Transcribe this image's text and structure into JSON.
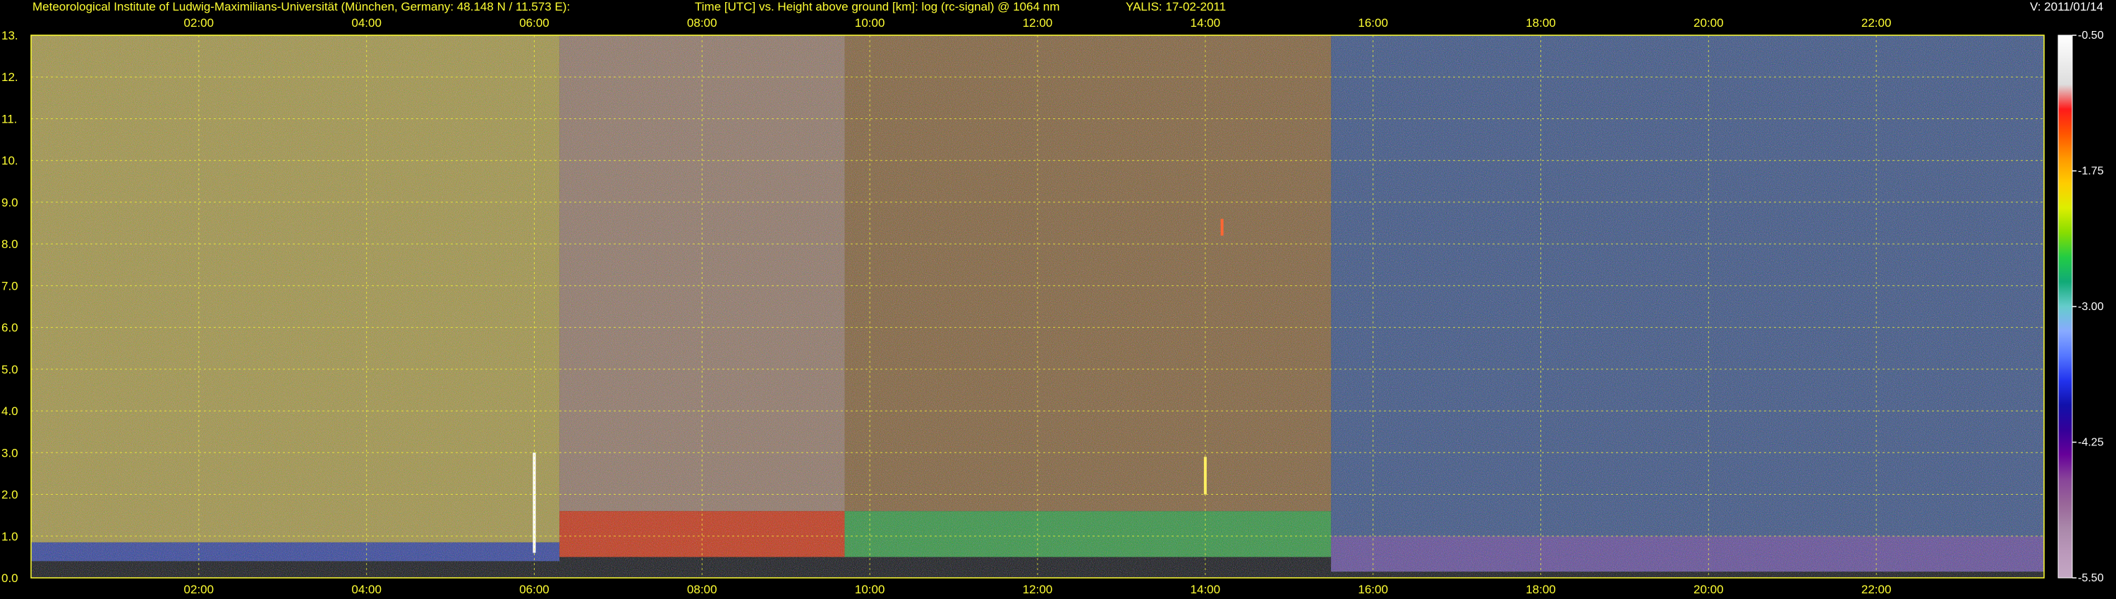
{
  "header": {
    "institute": "Meteorological Institute of Ludwig-Maximilians-Universität (München, Germany: 48.148 N / 11.573 E):",
    "plot_title": "Time [UTC] vs. Height above ground [km]: log (rc-signal) @ 1064 nm",
    "instrument": "YALIS: 17-02-2011",
    "version": "V: 2011/01/14"
  },
  "chart_data": {
    "type": "heatmap",
    "title": "Time [UTC] vs. Height above ground [km]: log (rc-signal) @ 1064 nm",
    "xlabel": "Time [UTC]",
    "ylabel": "Height above ground [km]",
    "xlim": [
      0,
      24
    ],
    "ylim": [
      0,
      13
    ],
    "x_ticks": [
      "02:00",
      "04:00",
      "06:00",
      "08:00",
      "10:00",
      "12:00",
      "14:00",
      "16:00",
      "18:00",
      "20:00",
      "22:00"
    ],
    "x_tick_values": [
      2,
      4,
      6,
      8,
      10,
      12,
      14,
      16,
      18,
      20,
      22
    ],
    "y_ticks": [
      "0.0",
      "1.0",
      "2.0",
      "3.0",
      "4.0",
      "5.0",
      "6.0",
      "7.0",
      "8.0",
      "9.0",
      "10.",
      "11.",
      "12.",
      "13."
    ],
    "y_tick_values": [
      0,
      1,
      2,
      3,
      4,
      5,
      6,
      7,
      8,
      9,
      10,
      11,
      12,
      13
    ],
    "grid": true,
    "colorbar": {
      "labels": [
        "-0.50",
        "-1.75",
        "-3.00",
        "-4.25",
        "-5.50"
      ],
      "values": [
        -0.5,
        -1.75,
        -3.0,
        -4.25,
        -5.5
      ],
      "colors": [
        "#ffffff",
        "#eeeeee",
        "#dddddd",
        "#ff1a1a",
        "#ff5500",
        "#ff9900",
        "#ffcc00",
        "#ddee00",
        "#88dd00",
        "#22cc44",
        "#11aa77",
        "#66cccc",
        "#88aaff",
        "#5577ff",
        "#2233ee",
        "#1111aa",
        "#330099",
        "#660099",
        "#884499",
        "#996699",
        "#aa88aa",
        "#bb99bb",
        "#c4a8c4"
      ]
    },
    "regions": [
      {
        "t0": 0,
        "t1": 6.3,
        "h0": 0.85,
        "h1": 13,
        "color": "#d2be55"
      },
      {
        "t0": 0,
        "t1": 6.3,
        "h0": 0.4,
        "h1": 0.85,
        "color": "#3c50c8"
      },
      {
        "t0": 6.3,
        "t1": 9.7,
        "h0": 1.6,
        "h1": 13,
        "color": "#b99682"
      },
      {
        "t0": 6.3,
        "t1": 9.7,
        "h0": 0.5,
        "h1": 1.6,
        "color": "#ff3c14"
      },
      {
        "t0": 9.7,
        "t1": 15.5,
        "h0": 0.5,
        "h1": 1.6,
        "color": "#3cbe50"
      },
      {
        "t0": 9.7,
        "t1": 15.5,
        "h0": 1.6,
        "h1": 13,
        "color": "#a57846"
      },
      {
        "t0": 15.5,
        "t1": 24,
        "h0": 0.15,
        "h1": 13,
        "color": "#4664aa"
      },
      {
        "t0": 15.5,
        "t1": 24,
        "h0": 0.15,
        "h1": 1.0,
        "color": "#6e46a0"
      }
    ],
    "features": [
      {
        "t": 6.0,
        "h0": 0.6,
        "h1": 3.0,
        "color": "#ffffff"
      },
      {
        "t": 14.0,
        "h0": 2.0,
        "h1": 2.9,
        "color": "#ffee66"
      },
      {
        "t": 14.2,
        "h0": 8.2,
        "h1": 8.6,
        "color": "#ff6633"
      }
    ]
  }
}
